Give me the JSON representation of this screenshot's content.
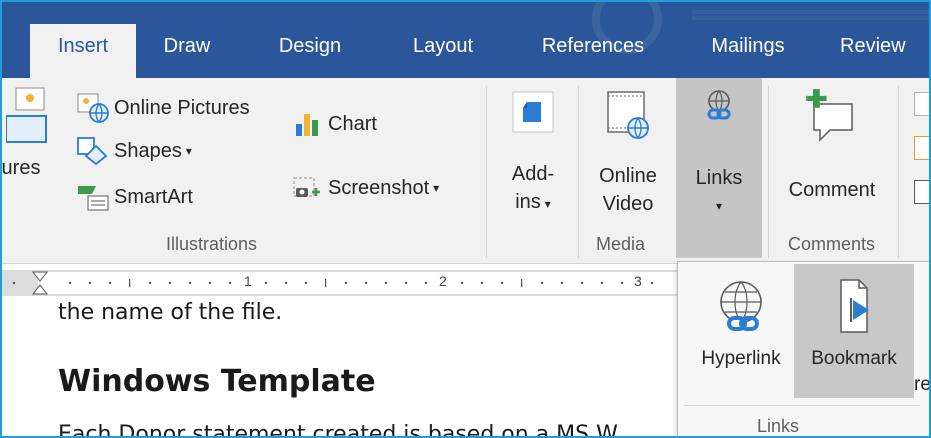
{
  "tabs": [
    "Insert",
    "Draw",
    "Design",
    "Layout",
    "References",
    "Mailings",
    "Review"
  ],
  "illustrations": {
    "pictures_label_partial": "tures",
    "online_pictures": "Online Pictures",
    "shapes": "Shapes",
    "smartart": "SmartArt",
    "chart": "Chart",
    "screenshot": "Screenshot",
    "group_label": "Illustrations"
  },
  "addins": {
    "line1": "Add-",
    "line2": "ins",
    "group_label": ""
  },
  "media": {
    "line1": "Online",
    "line2": "Video",
    "group_label": "Media"
  },
  "links_button": {
    "label": "Links"
  },
  "comments": {
    "label": "Comment",
    "group_label": "Comments"
  },
  "ruler": {
    "n1": "1",
    "n2": "2",
    "n3": "3"
  },
  "document": {
    "line_top": "the name of the file.",
    "heading": "Windows Template",
    "line_bottom": "Each Donor statement created is based on a MS W"
  },
  "links_popup": {
    "hyperlink": "Hyperlink",
    "bookmark": "Bookmark",
    "cross_ref_partial": "re",
    "group_label": "Links"
  },
  "colors": {
    "ribbon_blue": "#2b579a",
    "accent_border": "#1e9fd8",
    "icon_blue": "#2b7cd3",
    "icon_green": "#3c9a4d"
  },
  "icons": [
    "pictures-icon",
    "online-pictures-icon",
    "shapes-icon",
    "smartart-icon",
    "chart-icon",
    "screenshot-icon",
    "store-icon",
    "online-video-icon",
    "links-icon",
    "comment-icon",
    "hyperlink-icon",
    "bookmark-icon"
  ]
}
